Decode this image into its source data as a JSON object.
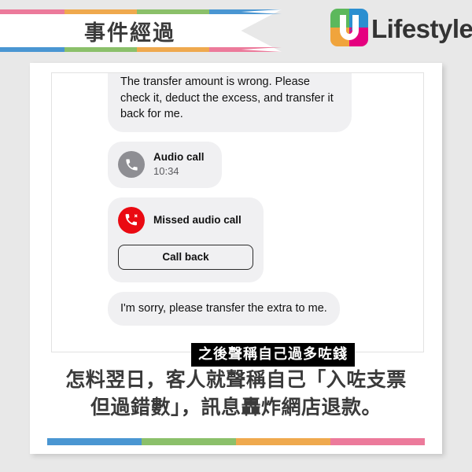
{
  "header": {
    "ribbon_title": "事件經過",
    "stripes_top": [
      "#ec7a9b",
      "#efa94e",
      "#8bc06a",
      "#4a96d2"
    ],
    "stripes_bottom": [
      "#4a96d2",
      "#8bc06a",
      "#efa94e",
      "#ec7a9b"
    ],
    "logo": {
      "icon_name": "u-lifestyle-logo",
      "wordmark": "Lifestyle",
      "quad_colors": {
        "top_left": "#5cb85c",
        "top_right": "#2b8fd0",
        "bottom_left": "#f0a43c",
        "bottom_right": "#e5007f"
      }
    }
  },
  "chat": {
    "messages": [
      {
        "type": "text",
        "side": "left",
        "text": "The transfer amount is wrong. Please check it, deduct the excess, and transfer it back for me."
      },
      {
        "type": "audio-call",
        "title": "Audio call",
        "time": "10:34",
        "icon": "phone-icon",
        "icon_color": "#8e8e93"
      },
      {
        "type": "missed-call",
        "title": "Missed audio call",
        "button_label": "Call back",
        "icon": "missed-phone-icon",
        "icon_color": "#ea0a12"
      },
      {
        "type": "text",
        "side": "left",
        "text": "I'm sorry, please transfer the extra to me."
      }
    ]
  },
  "overlay_chip": {
    "text": "之後聲稱自己過多咗錢",
    "bg": "#000000",
    "fg": "#ffffff"
  },
  "caption": {
    "line1": "怎料翌日，客人就聲稱自己「入咗支票",
    "line2": "但過錯數」，訊息轟炸網店退款。"
  },
  "bottom_bar": {
    "colors": [
      "#4a96d2",
      "#8bc06a",
      "#efa94e",
      "#ec7a9b"
    ]
  }
}
